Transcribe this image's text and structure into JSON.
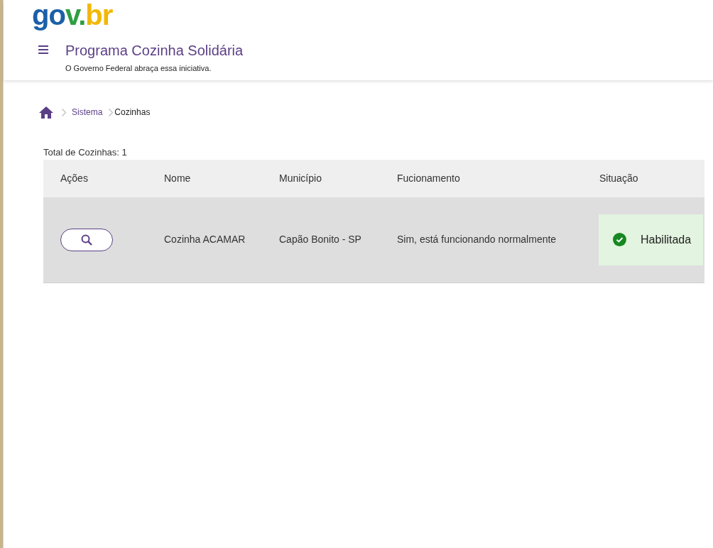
{
  "header": {
    "logo": "gov.br",
    "title": "Programa Cozinha Solidária",
    "subtitle": "O Governo Federal abraça essa iniciativa."
  },
  "breadcrumb": [
    {
      "label": "Sistema",
      "current": false
    },
    {
      "label": "Cozinhas",
      "current": true
    }
  ],
  "total": "Total de Cozinhas: 1",
  "table": {
    "columns": [
      "Ações",
      "Nome",
      "Município",
      "Fucionamento",
      "Situação"
    ],
    "rows": [
      {
        "nome": "Cozinha ACAMAR",
        "municipio": "Capão Bonito - SP",
        "funcionamento": "Sim, está funcionando normalmente",
        "situacao": {
          "label": "Habilitada",
          "kind": "success"
        }
      }
    ]
  }
}
